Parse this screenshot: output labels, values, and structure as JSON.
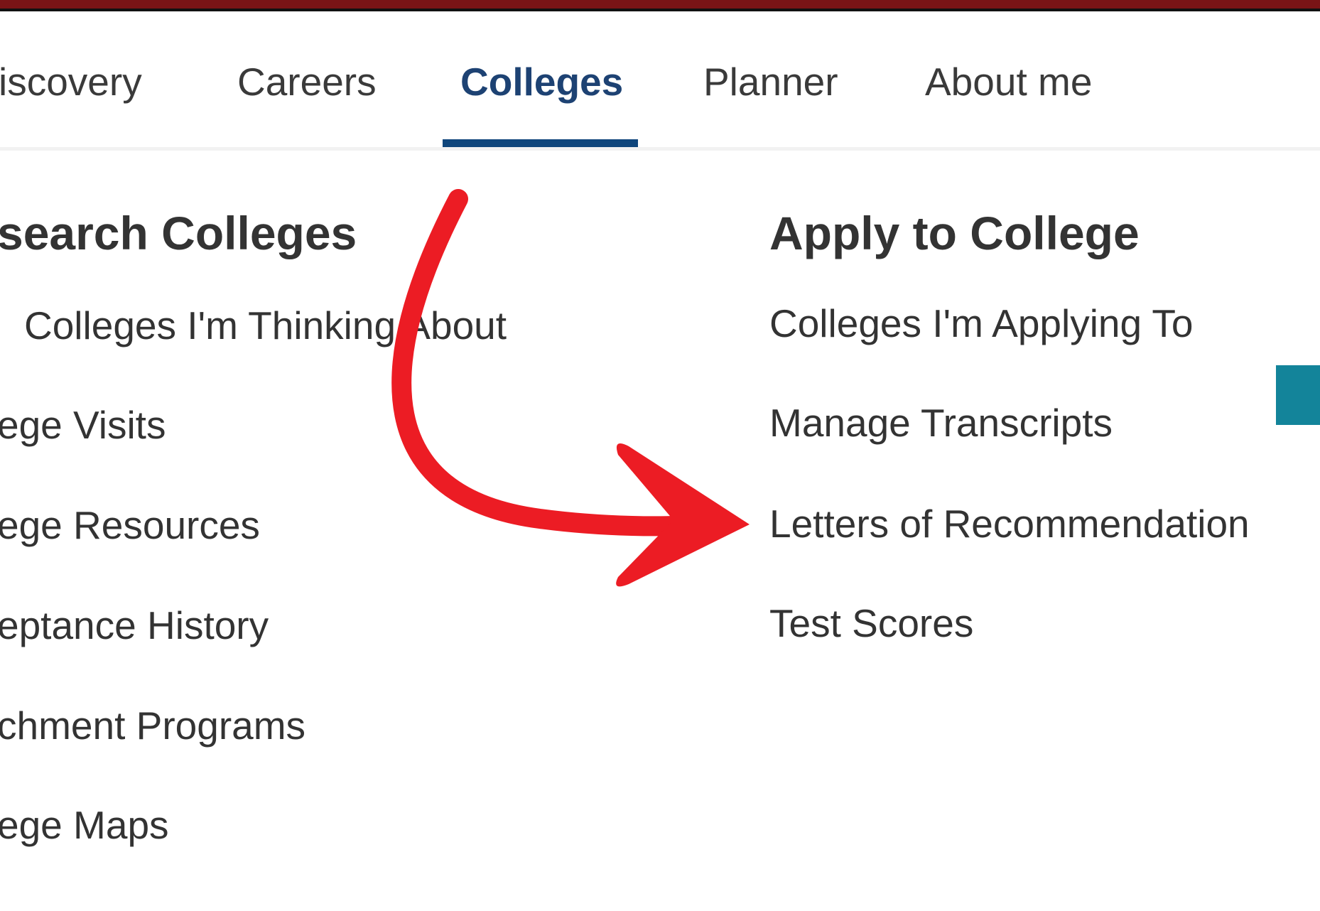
{
  "nav": {
    "tabs": [
      {
        "label": "iscovery"
      },
      {
        "label": "Careers"
      },
      {
        "label": "Colleges"
      },
      {
        "label": "Planner"
      },
      {
        "label": "About me"
      }
    ],
    "active_tab": "Colleges"
  },
  "research": {
    "heading": "search Colleges",
    "items": [
      {
        "label": "Colleges I'm Thinking About"
      },
      {
        "label": "ege Visits"
      },
      {
        "label": "ege Resources"
      },
      {
        "label": "eptance History"
      },
      {
        "label": "chment Programs"
      },
      {
        "label": "ege Maps"
      }
    ]
  },
  "apply": {
    "heading": "Apply to College",
    "items": [
      {
        "label": "Colleges I'm Applying To"
      },
      {
        "label": "Manage Transcripts"
      },
      {
        "label": "Letters of Recommendation"
      },
      {
        "label": "Test Scores"
      }
    ]
  },
  "annotation": {
    "arrow_color": "#ec1c24",
    "points_to": "Letters of Recommendation"
  },
  "colors": {
    "top_bar": "#7a1416",
    "active_tab": "#1d4273",
    "tab_underline": "#0f467c",
    "teal_accent": "#13849a"
  }
}
